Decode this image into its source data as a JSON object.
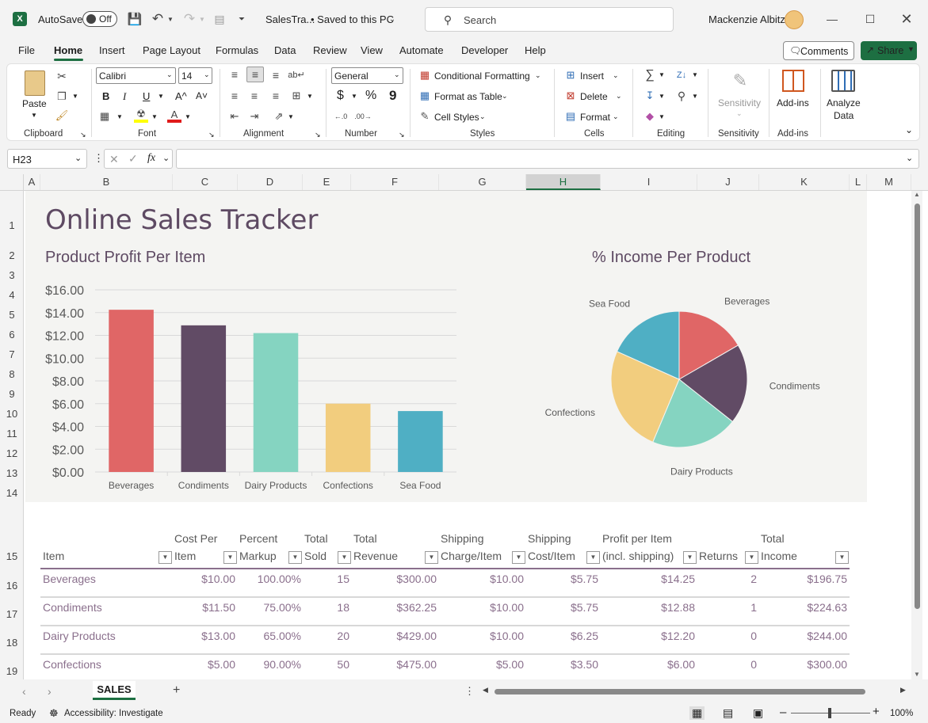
{
  "title_bar": {
    "autosave_label": "AutoSave",
    "autosave_state": "Off",
    "file_name": "SalesTra...",
    "save_status": "• Saved to this PC",
    "search_placeholder": "Search",
    "user_name": "Mackenzie Albitz"
  },
  "menu": [
    "File",
    "Home",
    "Insert",
    "Page Layout",
    "Formulas",
    "Data",
    "Review",
    "View",
    "Automate",
    "Developer",
    "Help"
  ],
  "menu_active": "Home",
  "comments_label": "Comments",
  "share_label": "Share",
  "ribbon": {
    "clipboard": {
      "label": "Clipboard",
      "paste": "Paste"
    },
    "font": {
      "label": "Font",
      "name": "Calibri",
      "size": "14",
      "bold": "B",
      "italic": "I",
      "underline": "U",
      "grow": "A^",
      "shrink": "A˅"
    },
    "alignment": {
      "label": "Alignment"
    },
    "number": {
      "label": "Number",
      "format": "General",
      "currency": "$",
      "percent": "%",
      "comma": "9"
    },
    "styles": {
      "label": "Styles",
      "conditional": "Conditional Formatting",
      "table": "Format as Table",
      "cell": "Cell Styles"
    },
    "cells": {
      "label": "Cells",
      "insert": "Insert",
      "delete": "Delete",
      "format": "Format"
    },
    "editing": {
      "label": "Editing"
    },
    "sensitivity": {
      "label": "Sensitivity",
      "button": "Sensitivity"
    },
    "addins": {
      "label": "Add-ins",
      "button": "Add-ins"
    },
    "analyze": {
      "line1": "Analyze",
      "line2": "Data"
    }
  },
  "formula_bar": {
    "name_box": "H23",
    "fx": "fx",
    "value": ""
  },
  "columns": [
    "A",
    "B",
    "C",
    "D",
    "E",
    "F",
    "G",
    "H",
    "I",
    "J",
    "K",
    "L",
    "M"
  ],
  "selected_column": "H",
  "rows": [
    "1",
    "2",
    "3",
    "4",
    "5",
    "6",
    "7",
    "8",
    "9",
    "10",
    "11",
    "12",
    "13",
    "14",
    "15",
    "16",
    "17",
    "18",
    "19"
  ],
  "dashboard": {
    "title": "Online Sales Tracker",
    "bar_title": "Product Profit Per Item",
    "pie_title": "% Income Per Product"
  },
  "chart_data": [
    {
      "type": "bar",
      "title": "Product Profit Per Item",
      "categories": [
        "Beverages",
        "Condiments",
        "Dairy Products",
        "Confections",
        "Sea Food"
      ],
      "values": [
        14.25,
        12.88,
        12.2,
        6.0,
        5.35
      ],
      "yticks": [
        "$0.00",
        "$2.00",
        "$4.00",
        "$6.00",
        "$8.00",
        "$10.00",
        "$12.00",
        "$14.00",
        "$16.00"
      ],
      "ylim": [
        0,
        16
      ],
      "colors": [
        "#e06666",
        "#614b65",
        "#85d4c1",
        "#f2cd7e",
        "#4fafc4"
      ],
      "grid": true
    },
    {
      "type": "pie",
      "title": "% Income Per Product",
      "labels": [
        "Beverages",
        "Condiments",
        "Dairy Products",
        "Confections",
        "Sea Food"
      ],
      "values": [
        196.75,
        224.63,
        244.0,
        300.0,
        216.0
      ],
      "colors": [
        "#e06666",
        "#614b65",
        "#85d4c1",
        "#f2cd7e",
        "#4fafc4"
      ]
    }
  ],
  "table": {
    "headers": [
      [
        "",
        "Item"
      ],
      [
        "Cost Per",
        "Item"
      ],
      [
        "Percent",
        "Markup"
      ],
      [
        "Total",
        "Sold"
      ],
      [
        "Total",
        "Revenue"
      ],
      [
        "Shipping",
        "Charge/Item"
      ],
      [
        "Shipping",
        "Cost/Item"
      ],
      [
        "Profit per Item",
        "(incl. shipping)"
      ],
      [
        "",
        "Returns"
      ],
      [
        "Total",
        "Income"
      ]
    ],
    "rows": [
      [
        "Beverages",
        "$10.00",
        "100.00%",
        "15",
        "$300.00",
        "$10.00",
        "$5.75",
        "$14.25",
        "2",
        "$196.75"
      ],
      [
        "Condiments",
        "$11.50",
        "75.00%",
        "18",
        "$362.25",
        "$10.00",
        "$5.75",
        "$12.88",
        "1",
        "$224.63"
      ],
      [
        "Dairy Products",
        "$13.00",
        "65.00%",
        "20",
        "$429.00",
        "$10.00",
        "$6.25",
        "$12.20",
        "0",
        "$244.00"
      ],
      [
        "Confections",
        "$5.00",
        "90.00%",
        "50",
        "$475.00",
        "$5.00",
        "$3.50",
        "$6.00",
        "0",
        "$300.00"
      ]
    ]
  },
  "sheet_tab": "SALES",
  "status": {
    "ready": "Ready",
    "accessibility": "Accessibility: Investigate",
    "zoom": "100%"
  }
}
